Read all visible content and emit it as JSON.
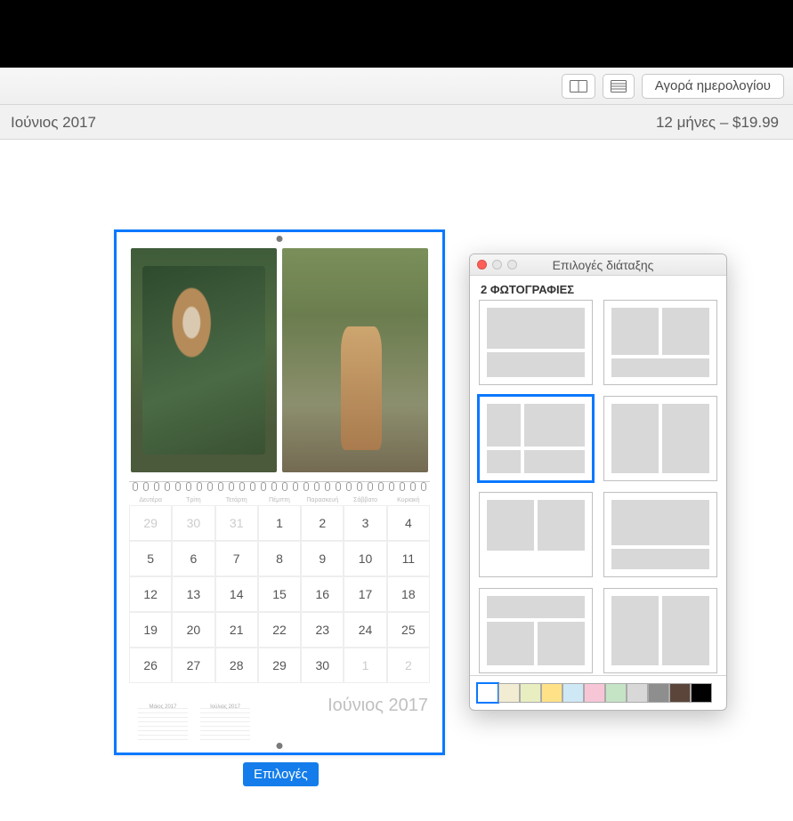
{
  "toolbar": {
    "buy_label": "Αγορά ημερολογίου"
  },
  "header": {
    "month_title": "Ιούνιος 2017",
    "price_label": "12 μήνες – $19.99"
  },
  "calendar": {
    "month_footer": "Ιούνιος 2017",
    "mini_prev_label": "Μάιος 2017",
    "mini_next_label": "Ιούλιος 2017",
    "day_headers": [
      "Δευτέρα",
      "Τρίτη",
      "Τετάρτη",
      "Πέμπτη",
      "Παρασκευή",
      "Σάββατο",
      "Κυριακή"
    ],
    "cells": [
      {
        "n": "29",
        "faded": true
      },
      {
        "n": "30",
        "faded": true
      },
      {
        "n": "31",
        "faded": true
      },
      {
        "n": "1"
      },
      {
        "n": "2"
      },
      {
        "n": "3"
      },
      {
        "n": "4"
      },
      {
        "n": "5"
      },
      {
        "n": "6"
      },
      {
        "n": "7"
      },
      {
        "n": "8"
      },
      {
        "n": "9"
      },
      {
        "n": "10"
      },
      {
        "n": "11"
      },
      {
        "n": "12"
      },
      {
        "n": "13"
      },
      {
        "n": "14"
      },
      {
        "n": "15"
      },
      {
        "n": "16"
      },
      {
        "n": "17"
      },
      {
        "n": "18"
      },
      {
        "n": "19"
      },
      {
        "n": "20"
      },
      {
        "n": "21"
      },
      {
        "n": "22"
      },
      {
        "n": "23"
      },
      {
        "n": "24"
      },
      {
        "n": "25"
      },
      {
        "n": "26"
      },
      {
        "n": "27"
      },
      {
        "n": "28"
      },
      {
        "n": "29"
      },
      {
        "n": "30"
      },
      {
        "n": "1",
        "faded": true
      },
      {
        "n": "2",
        "faded": true
      }
    ]
  },
  "options_button_label": "Επιλογές",
  "panel": {
    "title": "Επιλογές διάταξης",
    "section_label": "2 ΦΩΤΟΓΡΑΦΙΕΣ",
    "swatch_colors": [
      "#ffffff",
      "#f2ecd3",
      "#e8eec0",
      "#ffe287",
      "#cfe8f5",
      "#f6c6d6",
      "#c5e4c5",
      "#d8d8d8",
      "#8e8e8e",
      "#5b453a",
      "#000000"
    ],
    "selected_swatch": 0,
    "selected_layout": 2
  }
}
